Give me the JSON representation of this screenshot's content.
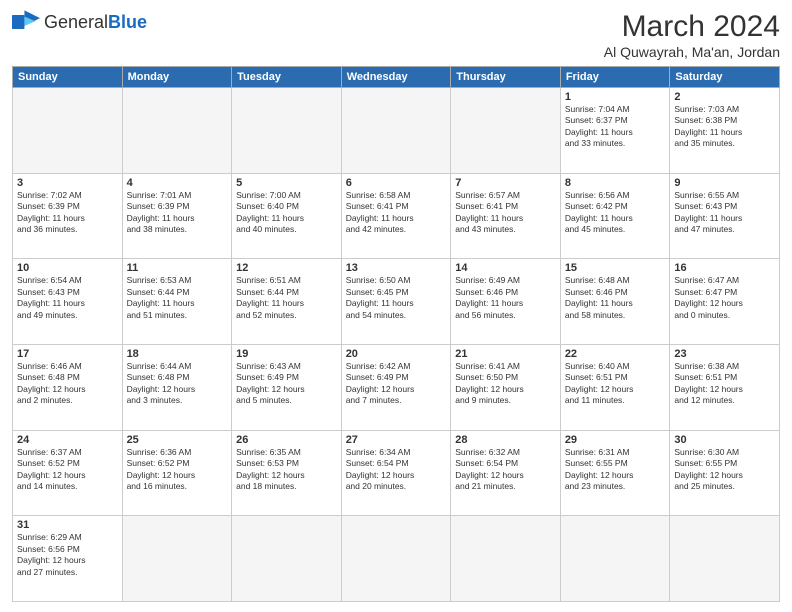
{
  "header": {
    "logo_general": "General",
    "logo_blue": "Blue",
    "month_title": "March 2024",
    "location": "Al Quwayrah, Ma'an, Jordan"
  },
  "weekdays": [
    "Sunday",
    "Monday",
    "Tuesday",
    "Wednesday",
    "Thursday",
    "Friday",
    "Saturday"
  ],
  "weeks": [
    [
      {
        "day": null,
        "info": null
      },
      {
        "day": null,
        "info": null
      },
      {
        "day": null,
        "info": null
      },
      {
        "day": null,
        "info": null
      },
      {
        "day": null,
        "info": null
      },
      {
        "day": "1",
        "info": "Sunrise: 7:04 AM\nSunset: 6:37 PM\nDaylight: 11 hours\nand 33 minutes."
      },
      {
        "day": "2",
        "info": "Sunrise: 7:03 AM\nSunset: 6:38 PM\nDaylight: 11 hours\nand 35 minutes."
      }
    ],
    [
      {
        "day": "3",
        "info": "Sunrise: 7:02 AM\nSunset: 6:39 PM\nDaylight: 11 hours\nand 36 minutes."
      },
      {
        "day": "4",
        "info": "Sunrise: 7:01 AM\nSunset: 6:39 PM\nDaylight: 11 hours\nand 38 minutes."
      },
      {
        "day": "5",
        "info": "Sunrise: 7:00 AM\nSunset: 6:40 PM\nDaylight: 11 hours\nand 40 minutes."
      },
      {
        "day": "6",
        "info": "Sunrise: 6:58 AM\nSunset: 6:41 PM\nDaylight: 11 hours\nand 42 minutes."
      },
      {
        "day": "7",
        "info": "Sunrise: 6:57 AM\nSunset: 6:41 PM\nDaylight: 11 hours\nand 43 minutes."
      },
      {
        "day": "8",
        "info": "Sunrise: 6:56 AM\nSunset: 6:42 PM\nDaylight: 11 hours\nand 45 minutes."
      },
      {
        "day": "9",
        "info": "Sunrise: 6:55 AM\nSunset: 6:43 PM\nDaylight: 11 hours\nand 47 minutes."
      }
    ],
    [
      {
        "day": "10",
        "info": "Sunrise: 6:54 AM\nSunset: 6:43 PM\nDaylight: 11 hours\nand 49 minutes."
      },
      {
        "day": "11",
        "info": "Sunrise: 6:53 AM\nSunset: 6:44 PM\nDaylight: 11 hours\nand 51 minutes."
      },
      {
        "day": "12",
        "info": "Sunrise: 6:51 AM\nSunset: 6:44 PM\nDaylight: 11 hours\nand 52 minutes."
      },
      {
        "day": "13",
        "info": "Sunrise: 6:50 AM\nSunset: 6:45 PM\nDaylight: 11 hours\nand 54 minutes."
      },
      {
        "day": "14",
        "info": "Sunrise: 6:49 AM\nSunset: 6:46 PM\nDaylight: 11 hours\nand 56 minutes."
      },
      {
        "day": "15",
        "info": "Sunrise: 6:48 AM\nSunset: 6:46 PM\nDaylight: 11 hours\nand 58 minutes."
      },
      {
        "day": "16",
        "info": "Sunrise: 6:47 AM\nSunset: 6:47 PM\nDaylight: 12 hours\nand 0 minutes."
      }
    ],
    [
      {
        "day": "17",
        "info": "Sunrise: 6:46 AM\nSunset: 6:48 PM\nDaylight: 12 hours\nand 2 minutes."
      },
      {
        "day": "18",
        "info": "Sunrise: 6:44 AM\nSunset: 6:48 PM\nDaylight: 12 hours\nand 3 minutes."
      },
      {
        "day": "19",
        "info": "Sunrise: 6:43 AM\nSunset: 6:49 PM\nDaylight: 12 hours\nand 5 minutes."
      },
      {
        "day": "20",
        "info": "Sunrise: 6:42 AM\nSunset: 6:49 PM\nDaylight: 12 hours\nand 7 minutes."
      },
      {
        "day": "21",
        "info": "Sunrise: 6:41 AM\nSunset: 6:50 PM\nDaylight: 12 hours\nand 9 minutes."
      },
      {
        "day": "22",
        "info": "Sunrise: 6:40 AM\nSunset: 6:51 PM\nDaylight: 12 hours\nand 11 minutes."
      },
      {
        "day": "23",
        "info": "Sunrise: 6:38 AM\nSunset: 6:51 PM\nDaylight: 12 hours\nand 12 minutes."
      }
    ],
    [
      {
        "day": "24",
        "info": "Sunrise: 6:37 AM\nSunset: 6:52 PM\nDaylight: 12 hours\nand 14 minutes."
      },
      {
        "day": "25",
        "info": "Sunrise: 6:36 AM\nSunset: 6:52 PM\nDaylight: 12 hours\nand 16 minutes."
      },
      {
        "day": "26",
        "info": "Sunrise: 6:35 AM\nSunset: 6:53 PM\nDaylight: 12 hours\nand 18 minutes."
      },
      {
        "day": "27",
        "info": "Sunrise: 6:34 AM\nSunset: 6:54 PM\nDaylight: 12 hours\nand 20 minutes."
      },
      {
        "day": "28",
        "info": "Sunrise: 6:32 AM\nSunset: 6:54 PM\nDaylight: 12 hours\nand 21 minutes."
      },
      {
        "day": "29",
        "info": "Sunrise: 6:31 AM\nSunset: 6:55 PM\nDaylight: 12 hours\nand 23 minutes."
      },
      {
        "day": "30",
        "info": "Sunrise: 6:30 AM\nSunset: 6:55 PM\nDaylight: 12 hours\nand 25 minutes."
      }
    ],
    [
      {
        "day": "31",
        "info": "Sunrise: 6:29 AM\nSunset: 6:56 PM\nDaylight: 12 hours\nand 27 minutes."
      },
      {
        "day": null,
        "info": null
      },
      {
        "day": null,
        "info": null
      },
      {
        "day": null,
        "info": null
      },
      {
        "day": null,
        "info": null
      },
      {
        "day": null,
        "info": null
      },
      {
        "day": null,
        "info": null
      }
    ]
  ]
}
